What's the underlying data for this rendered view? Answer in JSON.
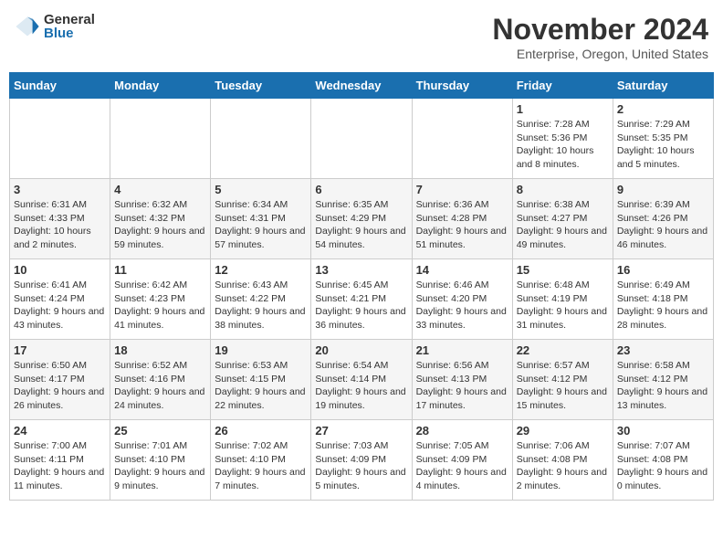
{
  "header": {
    "logo_general": "General",
    "logo_blue": "Blue",
    "month_title": "November 2024",
    "location": "Enterprise, Oregon, United States"
  },
  "days_of_week": [
    "Sunday",
    "Monday",
    "Tuesday",
    "Wednesday",
    "Thursday",
    "Friday",
    "Saturday"
  ],
  "weeks": [
    [
      {
        "day": "",
        "info": ""
      },
      {
        "day": "",
        "info": ""
      },
      {
        "day": "",
        "info": ""
      },
      {
        "day": "",
        "info": ""
      },
      {
        "day": "",
        "info": ""
      },
      {
        "day": "1",
        "info": "Sunrise: 7:28 AM\nSunset: 5:36 PM\nDaylight: 10 hours and 8 minutes."
      },
      {
        "day": "2",
        "info": "Sunrise: 7:29 AM\nSunset: 5:35 PM\nDaylight: 10 hours and 5 minutes."
      }
    ],
    [
      {
        "day": "3",
        "info": "Sunrise: 6:31 AM\nSunset: 4:33 PM\nDaylight: 10 hours and 2 minutes."
      },
      {
        "day": "4",
        "info": "Sunrise: 6:32 AM\nSunset: 4:32 PM\nDaylight: 9 hours and 59 minutes."
      },
      {
        "day": "5",
        "info": "Sunrise: 6:34 AM\nSunset: 4:31 PM\nDaylight: 9 hours and 57 minutes."
      },
      {
        "day": "6",
        "info": "Sunrise: 6:35 AM\nSunset: 4:29 PM\nDaylight: 9 hours and 54 minutes."
      },
      {
        "day": "7",
        "info": "Sunrise: 6:36 AM\nSunset: 4:28 PM\nDaylight: 9 hours and 51 minutes."
      },
      {
        "day": "8",
        "info": "Sunrise: 6:38 AM\nSunset: 4:27 PM\nDaylight: 9 hours and 49 minutes."
      },
      {
        "day": "9",
        "info": "Sunrise: 6:39 AM\nSunset: 4:26 PM\nDaylight: 9 hours and 46 minutes."
      }
    ],
    [
      {
        "day": "10",
        "info": "Sunrise: 6:41 AM\nSunset: 4:24 PM\nDaylight: 9 hours and 43 minutes."
      },
      {
        "day": "11",
        "info": "Sunrise: 6:42 AM\nSunset: 4:23 PM\nDaylight: 9 hours and 41 minutes."
      },
      {
        "day": "12",
        "info": "Sunrise: 6:43 AM\nSunset: 4:22 PM\nDaylight: 9 hours and 38 minutes."
      },
      {
        "day": "13",
        "info": "Sunrise: 6:45 AM\nSunset: 4:21 PM\nDaylight: 9 hours and 36 minutes."
      },
      {
        "day": "14",
        "info": "Sunrise: 6:46 AM\nSunset: 4:20 PM\nDaylight: 9 hours and 33 minutes."
      },
      {
        "day": "15",
        "info": "Sunrise: 6:48 AM\nSunset: 4:19 PM\nDaylight: 9 hours and 31 minutes."
      },
      {
        "day": "16",
        "info": "Sunrise: 6:49 AM\nSunset: 4:18 PM\nDaylight: 9 hours and 28 minutes."
      }
    ],
    [
      {
        "day": "17",
        "info": "Sunrise: 6:50 AM\nSunset: 4:17 PM\nDaylight: 9 hours and 26 minutes."
      },
      {
        "day": "18",
        "info": "Sunrise: 6:52 AM\nSunset: 4:16 PM\nDaylight: 9 hours and 24 minutes."
      },
      {
        "day": "19",
        "info": "Sunrise: 6:53 AM\nSunset: 4:15 PM\nDaylight: 9 hours and 22 minutes."
      },
      {
        "day": "20",
        "info": "Sunrise: 6:54 AM\nSunset: 4:14 PM\nDaylight: 9 hours and 19 minutes."
      },
      {
        "day": "21",
        "info": "Sunrise: 6:56 AM\nSunset: 4:13 PM\nDaylight: 9 hours and 17 minutes."
      },
      {
        "day": "22",
        "info": "Sunrise: 6:57 AM\nSunset: 4:12 PM\nDaylight: 9 hours and 15 minutes."
      },
      {
        "day": "23",
        "info": "Sunrise: 6:58 AM\nSunset: 4:12 PM\nDaylight: 9 hours and 13 minutes."
      }
    ],
    [
      {
        "day": "24",
        "info": "Sunrise: 7:00 AM\nSunset: 4:11 PM\nDaylight: 9 hours and 11 minutes."
      },
      {
        "day": "25",
        "info": "Sunrise: 7:01 AM\nSunset: 4:10 PM\nDaylight: 9 hours and 9 minutes."
      },
      {
        "day": "26",
        "info": "Sunrise: 7:02 AM\nSunset: 4:10 PM\nDaylight: 9 hours and 7 minutes."
      },
      {
        "day": "27",
        "info": "Sunrise: 7:03 AM\nSunset: 4:09 PM\nDaylight: 9 hours and 5 minutes."
      },
      {
        "day": "28",
        "info": "Sunrise: 7:05 AM\nSunset: 4:09 PM\nDaylight: 9 hours and 4 minutes."
      },
      {
        "day": "29",
        "info": "Sunrise: 7:06 AM\nSunset: 4:08 PM\nDaylight: 9 hours and 2 minutes."
      },
      {
        "day": "30",
        "info": "Sunrise: 7:07 AM\nSunset: 4:08 PM\nDaylight: 9 hours and 0 minutes."
      }
    ]
  ]
}
